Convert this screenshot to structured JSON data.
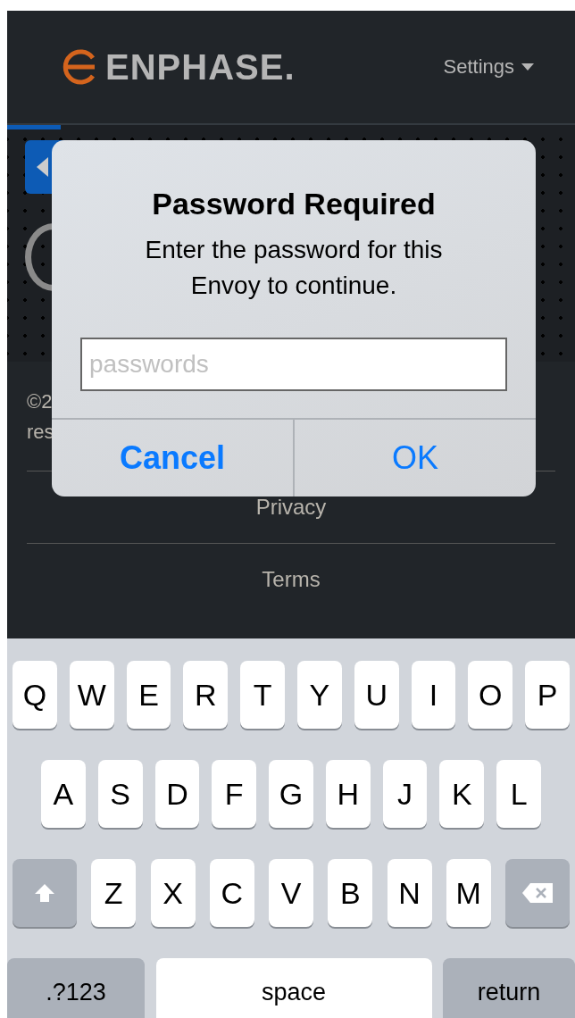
{
  "header": {
    "logo": "ENPHASE.",
    "menu": "Settings"
  },
  "footer": {
    "copyright_lines": [
      "©2",
      "res"
    ],
    "links": [
      "Privacy",
      "Terms"
    ]
  },
  "dialog": {
    "title": "Password Required",
    "message": "Enter the password for this Envoy to continue.",
    "field": {
      "placeholder": "passwords"
    },
    "buttons": [
      {
        "label": "Cancel",
        "kind": "cancel"
      },
      {
        "label": "OK",
        "kind": "default"
      }
    ]
  },
  "keyboard": {
    "rows": [
      [
        {
          "kind": "letter",
          "label": "Q"
        },
        {
          "kind": "letter",
          "label": "W"
        },
        {
          "kind": "letter",
          "label": "E"
        },
        {
          "kind": "letter",
          "label": "R"
        },
        {
          "kind": "letter",
          "label": "T"
        },
        {
          "kind": "letter",
          "label": "Y"
        },
        {
          "kind": "letter",
          "label": "U"
        },
        {
          "kind": "letter",
          "label": "I"
        },
        {
          "kind": "letter",
          "label": "O"
        },
        {
          "kind": "letter",
          "label": "P"
        }
      ],
      [
        {
          "kind": "letter",
          "label": "A"
        },
        {
          "kind": "letter",
          "label": "S"
        },
        {
          "kind": "letter",
          "label": "D"
        },
        {
          "kind": "letter",
          "label": "F"
        },
        {
          "kind": "letter",
          "label": "G"
        },
        {
          "kind": "letter",
          "label": "H"
        },
        {
          "kind": "letter",
          "label": "J"
        },
        {
          "kind": "letter",
          "label": "K"
        },
        {
          "kind": "letter",
          "label": "L"
        }
      ],
      [
        {
          "kind": "shift"
        },
        {
          "kind": "letter",
          "label": "Z"
        },
        {
          "kind": "letter",
          "label": "X"
        },
        {
          "kind": "letter",
          "label": "C"
        },
        {
          "kind": "letter",
          "label": "V"
        },
        {
          "kind": "letter",
          "label": "B"
        },
        {
          "kind": "letter",
          "label": "N"
        },
        {
          "kind": "letter",
          "label": "M"
        },
        {
          "kind": "backspace"
        }
      ]
    ],
    "bottom_bar": {
      "mode_key": ".?123",
      "space_key": "space",
      "return_key": "return"
    }
  }
}
